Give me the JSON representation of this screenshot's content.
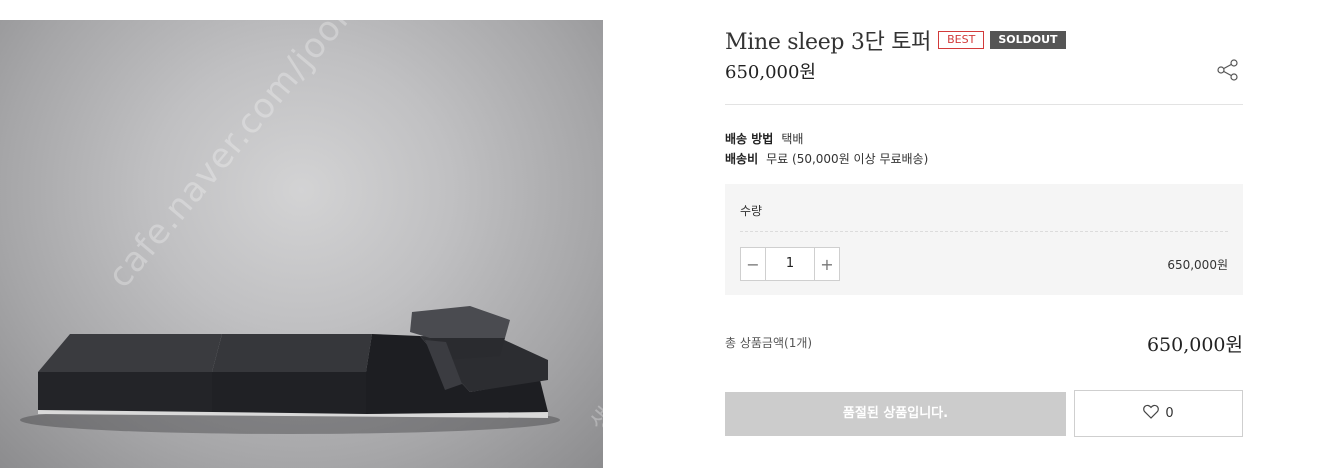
{
  "product": {
    "name": "Mine sleep 3단 토퍼",
    "badge_best": "BEST",
    "badge_soldout": "SOLDOUT",
    "price": "650,000원",
    "image_watermark": "cafe.naver.com/joonggonara",
    "image_watermark_partial": "생"
  },
  "shipping": {
    "method_label": "배송 방법",
    "method_value": "택배",
    "fee_label": "배송비",
    "fee_value": "무료 (50,000원 이상 무료배송)"
  },
  "quantity": {
    "label": "수량",
    "value": "1",
    "minus_glyph": "−",
    "plus_glyph": "+",
    "line_price": "650,000원"
  },
  "total": {
    "label": "총 상품금액(1개)",
    "price": "650,000원"
  },
  "actions": {
    "soldout_label": "품절된 상품입니다.",
    "wishlist_count": "0"
  },
  "icons": {
    "share": "share-icon",
    "heart": "heart-icon"
  },
  "colors": {
    "best_badge": "#d23a3a",
    "soldout_badge": "#555555",
    "soldout_button": "#cccccc"
  }
}
